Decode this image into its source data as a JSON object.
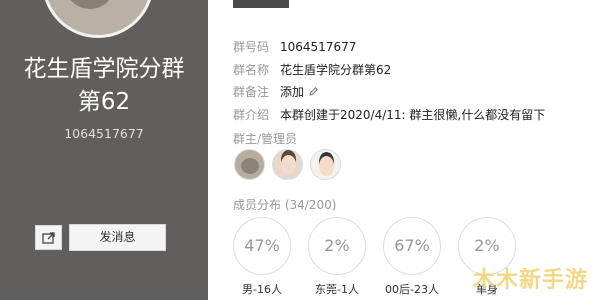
{
  "group": {
    "name_line1": "花生盾学院分群",
    "name_line2": "第62",
    "number": "1064517677"
  },
  "actions": {
    "send_message_label": "发消息",
    "share_icon": "share-icon"
  },
  "info": {
    "rows": [
      {
        "label": "群号码",
        "value": "1064517677"
      },
      {
        "label": "群名称",
        "value": "花生盾学院分群第62"
      },
      {
        "label": "群备注",
        "value": "添加"
      },
      {
        "label": "群介绍",
        "value": "本群创建于2020/4/11:  群主很懒,什么都没有留下"
      }
    ]
  },
  "admins": {
    "title": "群主/管理员",
    "count": 3
  },
  "members": {
    "title": "成员分布 (34/200)",
    "stats": [
      {
        "percent": "47%",
        "label": "男-16人"
      },
      {
        "percent": "2%",
        "label": "东莞-1人"
      },
      {
        "percent": "67%",
        "label": "00后-23人"
      },
      {
        "percent": "2%",
        "label": "单身"
      }
    ]
  },
  "watermark": "木木新手游",
  "colors": {
    "left_panel": "#615f5c",
    "label_text": "#999999",
    "value_text": "#222222",
    "watermark": "#f1d57c"
  }
}
